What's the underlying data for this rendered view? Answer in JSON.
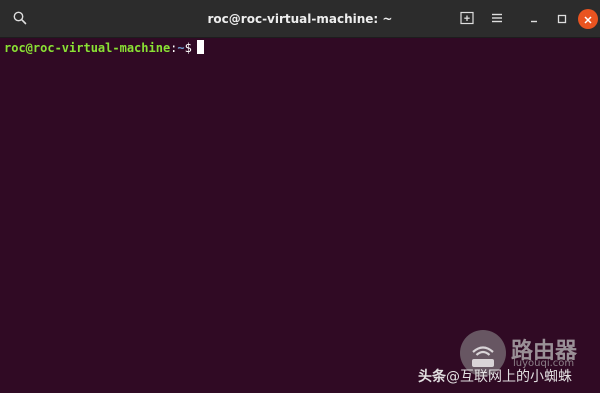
{
  "window": {
    "title": "roc@roc-virtual-machine: ~"
  },
  "terminal": {
    "prompt_user": "roc@roc-virtual-machine",
    "prompt_colon": ":",
    "prompt_path": "~",
    "prompt_symbol": "$"
  },
  "watermark": {
    "brand": "路由器",
    "url": "luyouqi.com",
    "caption_head": "头条",
    "caption_tail": "@互联网上的小蜘蛛"
  },
  "icons": {
    "search": "search-icon",
    "new_tab": "new-tab-icon",
    "menu": "hamburger-menu-icon",
    "minimize": "minimize-icon",
    "maximize": "maximize-icon",
    "close": "close-icon"
  },
  "colors": {
    "terminal_bg": "#300a24",
    "titlebar_bg": "#2c2c2c",
    "prompt_user": "#8ae234",
    "prompt_path": "#729fcf",
    "close_button": "#e95420"
  }
}
